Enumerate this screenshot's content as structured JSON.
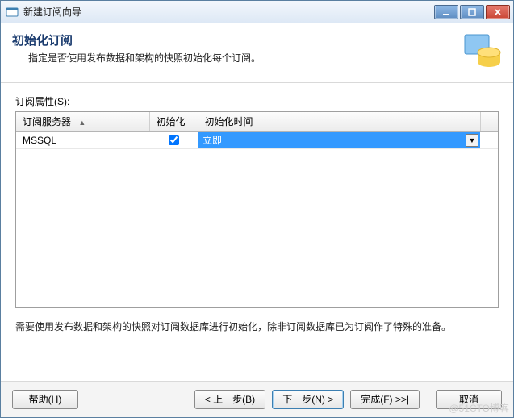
{
  "window": {
    "title": "新建订阅向导"
  },
  "header": {
    "title": "初始化订阅",
    "subtitle": "指定是否使用发布数据和架构的快照初始化每个订阅。"
  },
  "body": {
    "properties_label": "订阅属性(S):",
    "columns": {
      "server": "订阅服务器",
      "init": "初始化",
      "init_time": "初始化时间"
    },
    "rows": [
      {
        "server": "MSSQL",
        "init_checked": true,
        "init_time": "立即"
      }
    ],
    "footer_note": "需要使用发布数据和架构的快照对订阅数据库进行初始化，除非订阅数据库已为订阅作了特殊的准备。"
  },
  "buttons": {
    "help": "帮助(H)",
    "back": "< 上一步(B)",
    "next": "下一步(N) >",
    "finish": "完成(F) >>|",
    "cancel": "取消"
  },
  "watermark": "@51CTO博客"
}
